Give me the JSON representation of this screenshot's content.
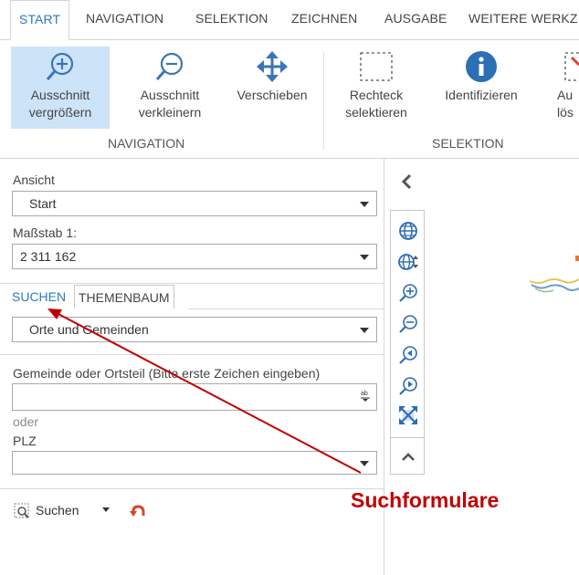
{
  "ribbon_tabs": [
    "START",
    "NAVIGATION",
    "SELEKTION",
    "ZEICHNEN",
    "AUSGABE",
    "WEITERE WERKZ"
  ],
  "ribbon": {
    "buttons": [
      {
        "label1": "Ausschnitt",
        "label2": "vergrößern",
        "icon": "zoom-in-icon",
        "active": true
      },
      {
        "label1": "Ausschnitt",
        "label2": "verkleinern",
        "icon": "zoom-out-icon",
        "active": false
      },
      {
        "label1": "Verschieben",
        "label2": "",
        "icon": "pan-move-icon",
        "active": false
      },
      {
        "label1": "Rechteck",
        "label2": "selektieren",
        "icon": "rectangle-select-icon",
        "active": false
      },
      {
        "label1": "Identifizieren",
        "label2": "",
        "icon": "info-icon",
        "active": false
      },
      {
        "label1": "Au",
        "label2": "lös",
        "icon": "clear-selection-icon",
        "active": false
      }
    ],
    "groups": [
      "NAVIGATION",
      "SELEKTION"
    ]
  },
  "panel": {
    "ansicht_label": "Ansicht",
    "ansicht_value": "Start",
    "massstab_label": "Maßstab 1:",
    "massstab_value": "2 311 162",
    "tabs": [
      "SUCHEN",
      "THEMENBAUM"
    ],
    "search_type_value": "Orte und Gemeinden",
    "gemeinde_label": "Gemeinde oder Ortsteil (Bitte erste Zeichen eingeben)",
    "gemeinde_value": "",
    "oder_label": "oder",
    "plz_label": "PLZ",
    "plz_value": "",
    "search_button_label": "Suchen"
  },
  "map_tools": [
    "globe-icon",
    "globe-zoom-icon",
    "zoom-in-icon",
    "zoom-out-icon",
    "zoom-previous-icon",
    "zoom-next-icon",
    "full-extent-icon",
    "chevron-up-icon"
  ],
  "annotation": {
    "text": "Suchformulare"
  },
  "colors": {
    "accent_blue": "#2b79c2",
    "active_button_bg": "#cde3f7",
    "annotation_red": "#c00000",
    "undo_red": "#d9452a"
  }
}
